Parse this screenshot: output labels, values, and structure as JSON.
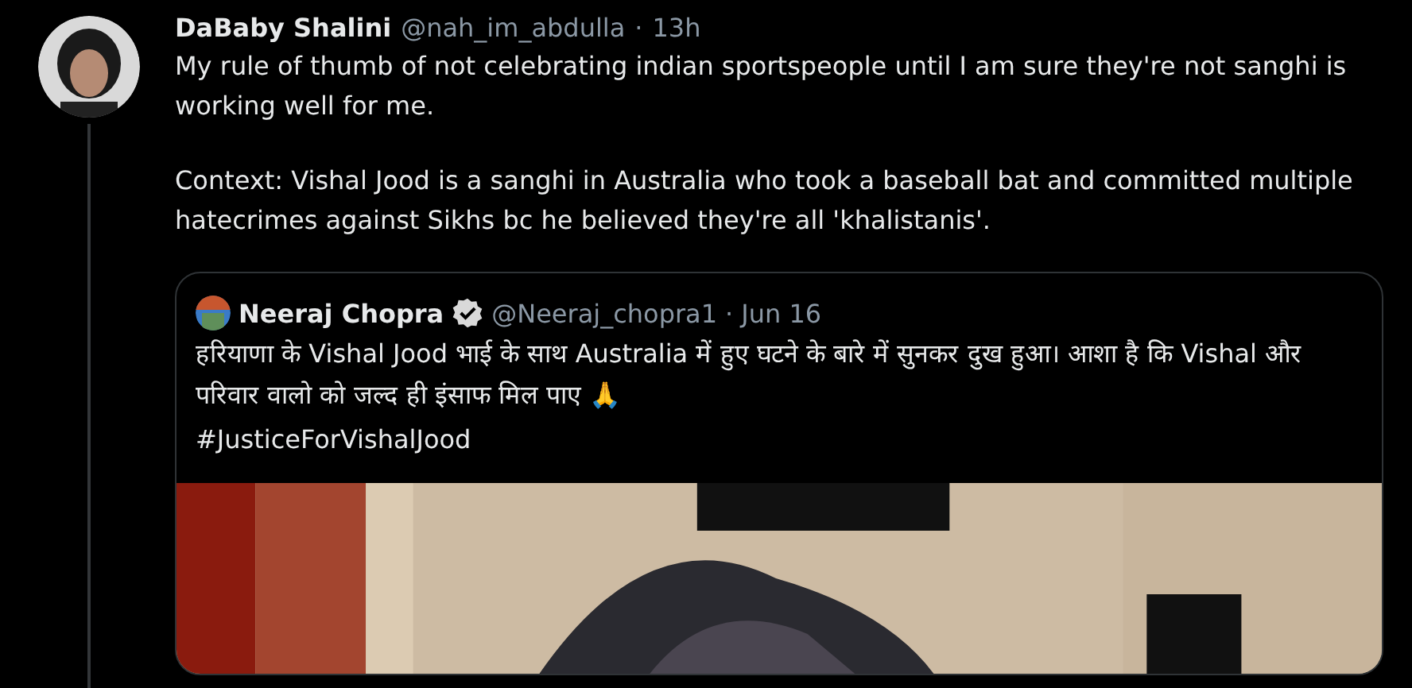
{
  "tweet": {
    "display_name": "DaBaby Shalini",
    "handle": "@nah_im_abdulla",
    "separator": "·",
    "time": "13h",
    "paragraphs": [
      "My rule of thumb of not celebrating indian sportspeople until I am sure they're not sanghi is working well for me.",
      "Context: Vishal Jood is a sanghi in Australia who took a baseball bat and committed multiple hatecrimes against Sikhs bc he believed they're all 'khalistanis'."
    ],
    "quoted_tweet": {
      "display_name": "Neeraj Chopra",
      "verified": true,
      "handle": "@Neeraj_chopra1",
      "separator": "·",
      "time": "Jun 16",
      "text": "हरियाणा के Vishal Jood भाई के साथ Australia में हुए घटने के बारे में सुनकर दुख हुआ। आशा है कि Vishal और परिवार वालो को जल्द ही इंसाफ मिल पाए 🙏",
      "hashtag": "#JusticeForVishalJood"
    }
  }
}
